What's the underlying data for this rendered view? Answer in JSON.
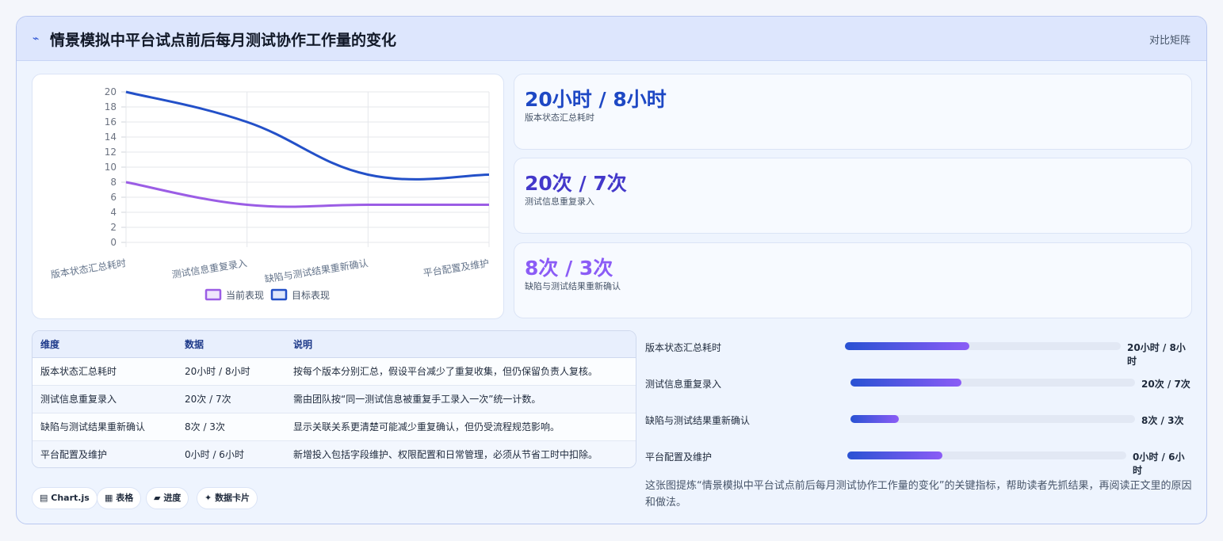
{
  "header": {
    "icon": "chart-line-icon",
    "title": "情景模拟中平台试点前后每月测试协作工作量的变化",
    "tag": "对比矩阵"
  },
  "colors": {
    "current": "#9b5de5",
    "target": "#2350c8",
    "accent": "#2f55d4"
  },
  "chart_data": {
    "type": "line",
    "categories": [
      "版本状态汇总耗时",
      "测试信息重复录入",
      "缺陷与测试结果重新确认",
      "平台配置及维护"
    ],
    "series": [
      {
        "name": "当前表现",
        "values": [
          8,
          5,
          5,
          5
        ]
      },
      {
        "name": "目标表现",
        "values": [
          20,
          16,
          9,
          9
        ]
      }
    ],
    "yticks": [
      "0",
      "2",
      "4",
      "6",
      "8",
      "10",
      "12",
      "14",
      "16",
      "18",
      "20"
    ],
    "ylim": [
      0,
      20
    ],
    "grid": true,
    "legend": "bottom"
  },
  "stats": [
    {
      "value": "20小时 / 8小时",
      "label": "版本状态汇总耗时",
      "color": "#1e48c4"
    },
    {
      "value": "20次 / 7次",
      "label": "测试信息重复录入",
      "color": "#4338ca"
    },
    {
      "value": "8次 / 3次",
      "label": "缺陷与测试结果重新确认",
      "color": "#8b5cf6"
    }
  ],
  "table": {
    "headers": [
      "维度",
      "数据",
      "说明"
    ],
    "rows": [
      [
        "版本状态汇总耗时",
        "20小时 / 8小时",
        "按每个版本分别汇总，假设平台减少了重复收集，但仍保留负责人复核。"
      ],
      [
        "测试信息重复录入",
        "20次 / 7次",
        "需由团队按“同一测试信息被重复手工录入一次”统一计数。"
      ],
      [
        "缺陷与测试结果重新确认",
        "8次 / 3次",
        "显示关联关系更清楚可能减少重复确认，但仍受流程规范影响。"
      ],
      [
        "平台配置及维护",
        "0小时 / 6小时",
        "新增投入包括字段维护、权限配置和日常管理，必须从节省工时中扣除。"
      ]
    ]
  },
  "progress": [
    {
      "label": "版本状态汇总耗时",
      "value": "20小时 / 8小时",
      "fraction": 0.45
    },
    {
      "label": "测试信息重复录入",
      "value": "20次 / 7次",
      "fraction": 0.39
    },
    {
      "label": "缺陷与测试结果重新确认",
      "value": "8次 / 3次",
      "fraction": 0.17
    },
    {
      "label": "平台配置及维护",
      "value": "0小时 / 6小时",
      "fraction": 0.34
    }
  ],
  "note": "这张图提炼“情景模拟中平台试点前后每月测试协作工作量的变化”的关键指标，帮助读者先抓结果，再阅读正文里的原因和做法。",
  "pills": [
    {
      "icon": "chart-icon",
      "label": "Chart.js"
    },
    {
      "icon": "table-icon",
      "label": "表格"
    },
    {
      "icon": "progress-icon",
      "label": "进度"
    },
    {
      "icon": "sparkle-icon",
      "label": "数据卡片"
    }
  ]
}
